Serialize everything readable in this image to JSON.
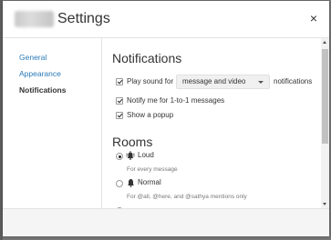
{
  "dialog": {
    "title": "Settings",
    "close_icon": "close-icon",
    "close_glyph": "×"
  },
  "sidebar": {
    "items": [
      {
        "label": "General",
        "active": false
      },
      {
        "label": "Appearance",
        "active": false
      },
      {
        "label": "Notifications",
        "active": true
      }
    ]
  },
  "notifications": {
    "heading": "Notifications",
    "play_sound": {
      "checked": true,
      "prefix": "Play sound for",
      "select_value": "message and video",
      "suffix": "notifications"
    },
    "notify_one_to_one": {
      "checked": true,
      "label": "Notify me for 1-to-1 messages"
    },
    "show_popup": {
      "checked": true,
      "label": "Show a popup"
    }
  },
  "rooms": {
    "heading": "Rooms",
    "options": [
      {
        "label": "Loud",
        "description": "For every message",
        "icon": "bell-ringing-icon",
        "selected": true
      },
      {
        "label": "Normal",
        "description": "For @all, @here, and @sathya mentions only",
        "icon": "bell-icon",
        "selected": false
      }
    ]
  },
  "colors": {
    "link": "#2a7ab8",
    "text": "#333333",
    "muted": "#777777"
  }
}
